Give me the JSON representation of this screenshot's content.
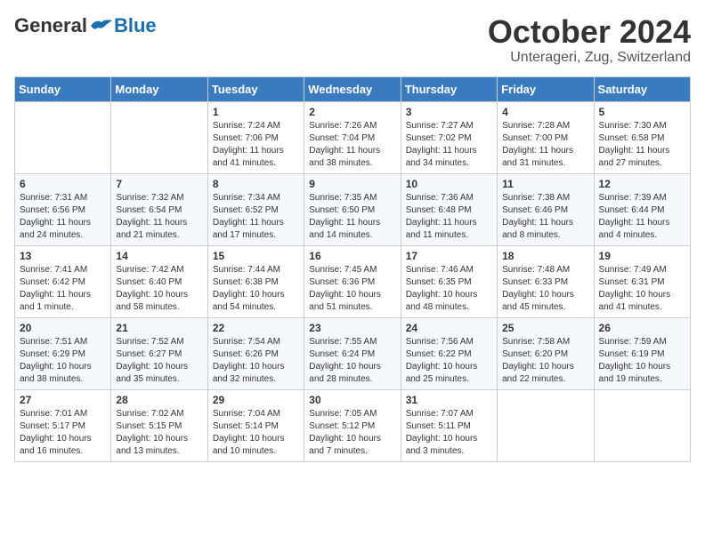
{
  "logo": {
    "general": "General",
    "blue": "Blue"
  },
  "title": "October 2024",
  "location": "Unterageri, Zug, Switzerland",
  "weekdays": [
    "Sunday",
    "Monday",
    "Tuesday",
    "Wednesday",
    "Thursday",
    "Friday",
    "Saturday"
  ],
  "weeks": [
    [
      {
        "day": "",
        "content": ""
      },
      {
        "day": "",
        "content": ""
      },
      {
        "day": "1",
        "content": "Sunrise: 7:24 AM\nSunset: 7:06 PM\nDaylight: 11 hours and 41 minutes."
      },
      {
        "day": "2",
        "content": "Sunrise: 7:26 AM\nSunset: 7:04 PM\nDaylight: 11 hours and 38 minutes."
      },
      {
        "day": "3",
        "content": "Sunrise: 7:27 AM\nSunset: 7:02 PM\nDaylight: 11 hours and 34 minutes."
      },
      {
        "day": "4",
        "content": "Sunrise: 7:28 AM\nSunset: 7:00 PM\nDaylight: 11 hours and 31 minutes."
      },
      {
        "day": "5",
        "content": "Sunrise: 7:30 AM\nSunset: 6:58 PM\nDaylight: 11 hours and 27 minutes."
      }
    ],
    [
      {
        "day": "6",
        "content": "Sunrise: 7:31 AM\nSunset: 6:56 PM\nDaylight: 11 hours and 24 minutes."
      },
      {
        "day": "7",
        "content": "Sunrise: 7:32 AM\nSunset: 6:54 PM\nDaylight: 11 hours and 21 minutes."
      },
      {
        "day": "8",
        "content": "Sunrise: 7:34 AM\nSunset: 6:52 PM\nDaylight: 11 hours and 17 minutes."
      },
      {
        "day": "9",
        "content": "Sunrise: 7:35 AM\nSunset: 6:50 PM\nDaylight: 11 hours and 14 minutes."
      },
      {
        "day": "10",
        "content": "Sunrise: 7:36 AM\nSunset: 6:48 PM\nDaylight: 11 hours and 11 minutes."
      },
      {
        "day": "11",
        "content": "Sunrise: 7:38 AM\nSunset: 6:46 PM\nDaylight: 11 hours and 8 minutes."
      },
      {
        "day": "12",
        "content": "Sunrise: 7:39 AM\nSunset: 6:44 PM\nDaylight: 11 hours and 4 minutes."
      }
    ],
    [
      {
        "day": "13",
        "content": "Sunrise: 7:41 AM\nSunset: 6:42 PM\nDaylight: 11 hours and 1 minute."
      },
      {
        "day": "14",
        "content": "Sunrise: 7:42 AM\nSunset: 6:40 PM\nDaylight: 10 hours and 58 minutes."
      },
      {
        "day": "15",
        "content": "Sunrise: 7:44 AM\nSunset: 6:38 PM\nDaylight: 10 hours and 54 minutes."
      },
      {
        "day": "16",
        "content": "Sunrise: 7:45 AM\nSunset: 6:36 PM\nDaylight: 10 hours and 51 minutes."
      },
      {
        "day": "17",
        "content": "Sunrise: 7:46 AM\nSunset: 6:35 PM\nDaylight: 10 hours and 48 minutes."
      },
      {
        "day": "18",
        "content": "Sunrise: 7:48 AM\nSunset: 6:33 PM\nDaylight: 10 hours and 45 minutes."
      },
      {
        "day": "19",
        "content": "Sunrise: 7:49 AM\nSunset: 6:31 PM\nDaylight: 10 hours and 41 minutes."
      }
    ],
    [
      {
        "day": "20",
        "content": "Sunrise: 7:51 AM\nSunset: 6:29 PM\nDaylight: 10 hours and 38 minutes."
      },
      {
        "day": "21",
        "content": "Sunrise: 7:52 AM\nSunset: 6:27 PM\nDaylight: 10 hours and 35 minutes."
      },
      {
        "day": "22",
        "content": "Sunrise: 7:54 AM\nSunset: 6:26 PM\nDaylight: 10 hours and 32 minutes."
      },
      {
        "day": "23",
        "content": "Sunrise: 7:55 AM\nSunset: 6:24 PM\nDaylight: 10 hours and 28 minutes."
      },
      {
        "day": "24",
        "content": "Sunrise: 7:56 AM\nSunset: 6:22 PM\nDaylight: 10 hours and 25 minutes."
      },
      {
        "day": "25",
        "content": "Sunrise: 7:58 AM\nSunset: 6:20 PM\nDaylight: 10 hours and 22 minutes."
      },
      {
        "day": "26",
        "content": "Sunrise: 7:59 AM\nSunset: 6:19 PM\nDaylight: 10 hours and 19 minutes."
      }
    ],
    [
      {
        "day": "27",
        "content": "Sunrise: 7:01 AM\nSunset: 5:17 PM\nDaylight: 10 hours and 16 minutes."
      },
      {
        "day": "28",
        "content": "Sunrise: 7:02 AM\nSunset: 5:15 PM\nDaylight: 10 hours and 13 minutes."
      },
      {
        "day": "29",
        "content": "Sunrise: 7:04 AM\nSunset: 5:14 PM\nDaylight: 10 hours and 10 minutes."
      },
      {
        "day": "30",
        "content": "Sunrise: 7:05 AM\nSunset: 5:12 PM\nDaylight: 10 hours and 7 minutes."
      },
      {
        "day": "31",
        "content": "Sunrise: 7:07 AM\nSunset: 5:11 PM\nDaylight: 10 hours and 3 minutes."
      },
      {
        "day": "",
        "content": ""
      },
      {
        "day": "",
        "content": ""
      }
    ]
  ]
}
